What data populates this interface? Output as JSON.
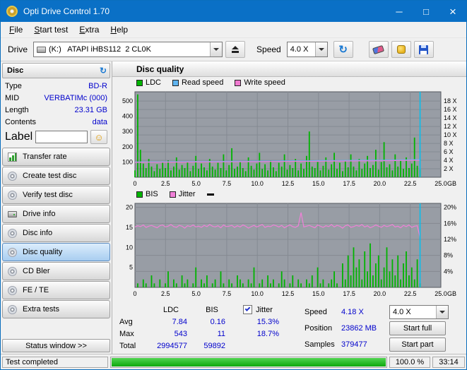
{
  "window": {
    "title": "Opti Drive Control 1.70"
  },
  "icons": {
    "minimize": "─",
    "maximize": "□",
    "close": "×",
    "refresh": "↻",
    "smiley": "☺"
  },
  "colors": {
    "titlebar": "#0a70c6",
    "value_text": "#0000cc",
    "active_button": "#a8cdf0",
    "progress_green": "#17b317",
    "chart_bg": "#989da5"
  },
  "menu": {
    "items": [
      "File",
      "Start test",
      "Extra",
      "Help"
    ]
  },
  "toolbar": {
    "drive_label": "Drive",
    "drive_value": "(K:)   ATAPI iHBS112  2 CL0K",
    "speed_label": "Speed",
    "speed_value": "4.0 X"
  },
  "sidebar": {
    "disc_header": "Disc",
    "fields": [
      {
        "label": "Type",
        "value": "BD-R"
      },
      {
        "label": "MID",
        "value": "VERBATIMc (000)"
      },
      {
        "label": "Length",
        "value": "23.31 GB"
      },
      {
        "label": "Contents",
        "value": "data"
      }
    ],
    "label_label": "Label",
    "label_value": "",
    "buttons": [
      "Transfer rate",
      "Create test disc",
      "Verify test disc",
      "Drive info",
      "Disc info",
      "Disc quality",
      "CD Bler",
      "FE / TE",
      "Extra tests"
    ],
    "active_index": 5,
    "status_button": "Status window >>"
  },
  "main": {
    "title": "Disc quality"
  },
  "stats": {
    "col_ldc": "LDC",
    "col_bis": "BIS",
    "col_jitter": "Jitter",
    "jitter_checked": true,
    "rows": [
      {
        "label": "Avg",
        "ldc": "7.84",
        "bis": "0.16",
        "jitter": "15.3%"
      },
      {
        "label": "Max",
        "ldc": "543",
        "bis": "11",
        "jitter": "18.7%"
      },
      {
        "label": "Total",
        "ldc": "2994577",
        "bis": "59892",
        "jitter": ""
      }
    ]
  },
  "panel": {
    "speed_label": "Speed",
    "speed_value": "4.18 X",
    "speed_combo": "4.0 X",
    "position_label": "Position",
    "position_value": "23862 MB",
    "samples_label": "Samples",
    "samples_value": "379477",
    "start_full": "Start full",
    "start_part": "Start part"
  },
  "status": {
    "text": "Test completed",
    "percent": "100.0 %",
    "time": "33:14",
    "progress": 100
  },
  "chart_data": [
    {
      "id": "ldc-speed",
      "type": "bar",
      "x_range": [
        0,
        25
      ],
      "x_ticks": [
        0,
        2.5,
        5,
        7.5,
        10,
        12.5,
        15,
        17.5,
        20,
        22.5,
        25
      ],
      "x_unit": "GB",
      "data_span": [
        0,
        23.3
      ],
      "marker_x": 23.3,
      "y_left": {
        "max": 560,
        "ticks": [
          100,
          200,
          300,
          400,
          500
        ]
      },
      "y_right": {
        "max": 20.2,
        "ticks": [
          2,
          4,
          6,
          8,
          10,
          12,
          14,
          16,
          18
        ],
        "suffix": " X"
      },
      "colors": {
        "bg": "#989da5",
        "border": "#55585e",
        "grid": "#858a92",
        "marker": "#00c0f0"
      },
      "series": [
        {
          "name": "LDC",
          "type": "bar",
          "color": "#00b400",
          "values": [
            45,
            543,
            180,
            90,
            60,
            120,
            70,
            40,
            85,
            55,
            95,
            60,
            110,
            45,
            70,
            130,
            50,
            80,
            60,
            100,
            40,
            75,
            140,
            55,
            90,
            65,
            45,
            120,
            70,
            50,
            95,
            60,
            150,
            45,
            80,
            190,
            55,
            70,
            100,
            60,
            40,
            130,
            75,
            50,
            90,
            160,
            55,
            85,
            45,
            110,
            65,
            40,
            95,
            70,
            150,
            50,
            80,
            60,
            120,
            45,
            90,
            55,
            140,
            300,
            70,
            60,
            100,
            45,
            75,
            130,
            50,
            85,
            160,
            55,
            95,
            40,
            110,
            65,
            150,
            70,
            45,
            120,
            55,
            90,
            140,
            60,
            80,
            180,
            50,
            100,
            230,
            65,
            85,
            45,
            150,
            70,
            110,
            55,
            130,
            60,
            90,
            260,
            75,
            50
          ]
        },
        {
          "name": "Read speed",
          "type": "line",
          "color": "#5fb4f0",
          "values": [
            100,
            101,
            101,
            102,
            102,
            103,
            103,
            104,
            105,
            105,
            106,
            106,
            107,
            108,
            108,
            109,
            109,
            110,
            111,
            111,
            112,
            113,
            114,
            116
          ]
        },
        {
          "name": "Write speed",
          "type": "line",
          "color": "#f07ad0",
          "values": [
            97,
            98,
            98,
            99,
            99,
            100,
            100,
            101,
            101,
            102,
            102,
            103,
            103,
            104,
            104,
            105,
            106,
            106,
            107,
            107,
            108,
            109,
            110,
            111
          ]
        }
      ]
    },
    {
      "id": "bis-jitter",
      "type": "bar",
      "x_range": [
        0,
        25
      ],
      "x_ticks": [
        0,
        2.5,
        5,
        7.5,
        10,
        12.5,
        15,
        17.5,
        20,
        22.5,
        25
      ],
      "x_unit": "GB",
      "data_span": [
        0,
        23.3
      ],
      "marker_x": 23.3,
      "y_left": {
        "max": 21,
        "ticks": [
          5,
          10,
          15,
          20
        ]
      },
      "y_right": {
        "max": 21,
        "ticks": [
          4,
          8,
          12,
          16,
          20
        ],
        "suffix": "%"
      },
      "colors": {
        "bg": "#989da5",
        "border": "#55585e",
        "grid": "#858a92",
        "marker": "#00c0f0"
      },
      "legend_extra": {
        "name": "position-marker",
        "color": "#000000"
      },
      "series": [
        {
          "name": "BIS",
          "type": "bar",
          "color": "#00b400",
          "values": [
            0,
            1,
            0,
            2,
            1,
            0,
            3,
            1,
            0,
            2,
            0,
            1,
            4,
            0,
            2,
            1,
            0,
            3,
            1,
            2,
            0,
            1,
            5,
            0,
            2,
            1,
            3,
            0,
            1,
            2,
            0,
            4,
            1,
            0,
            2,
            1,
            0,
            3,
            2,
            1,
            0,
            2,
            1,
            5,
            0,
            1,
            2,
            0,
            3,
            1,
            2,
            0,
            1,
            4,
            2,
            0,
            1,
            3,
            0,
            2,
            1,
            0,
            2,
            1,
            3,
            0,
            5,
            1,
            2,
            0,
            1,
            2,
            4,
            1,
            0,
            6,
            2,
            8,
            3,
            10,
            5,
            7,
            2,
            9,
            4,
            11,
            3,
            6,
            8,
            2,
            5,
            10,
            4,
            7,
            3,
            8,
            2,
            6,
            9,
            3,
            5,
            2,
            7,
            1
          ]
        },
        {
          "name": "Jitter",
          "type": "line",
          "color": "#f080d8",
          "values": [
            15.1,
            15.4,
            15.2,
            15.6,
            15.0,
            15.3,
            15.5,
            15.2,
            14.9,
            15.4,
            15.6,
            15.1,
            15.3,
            15.7,
            15.2,
            15.0,
            15.5,
            15.3,
            14.8,
            15.4,
            15.2,
            15.6,
            15.1,
            15.3,
            15.0,
            15.5,
            15.2,
            15.7,
            15.3,
            15.1,
            15.4,
            14.9,
            15.6,
            15.2,
            15.3,
            15.5,
            15.0,
            15.4,
            15.1,
            15.6,
            15.3,
            14.8,
            15.2,
            15.5,
            15.1,
            15.4,
            15.7,
            15.0,
            15.3,
            15.2,
            15.6,
            15.4,
            15.1,
            15.5,
            14.9,
            15.3,
            15.6,
            15.2,
            15.0,
            15.4,
            18.7,
            15.1,
            15.3,
            15.5,
            15.2,
            14.9,
            15.6,
            15.3,
            15.0,
            15.4,
            15.2,
            15.7,
            15.1,
            15.5,
            15.3,
            14.8,
            15.4,
            15.6,
            15.0,
            15.2,
            15.5,
            15.3,
            15.7,
            15.1,
            15.4,
            14.9,
            15.2,
            15.6,
            15.3,
            15.0,
            15.5,
            15.2,
            15.4,
            15.7,
            15.1,
            15.3,
            14.9,
            15.5,
            15.2,
            15.6,
            15.0,
            15.3,
            15.4,
            12.5
          ]
        }
      ]
    }
  ]
}
